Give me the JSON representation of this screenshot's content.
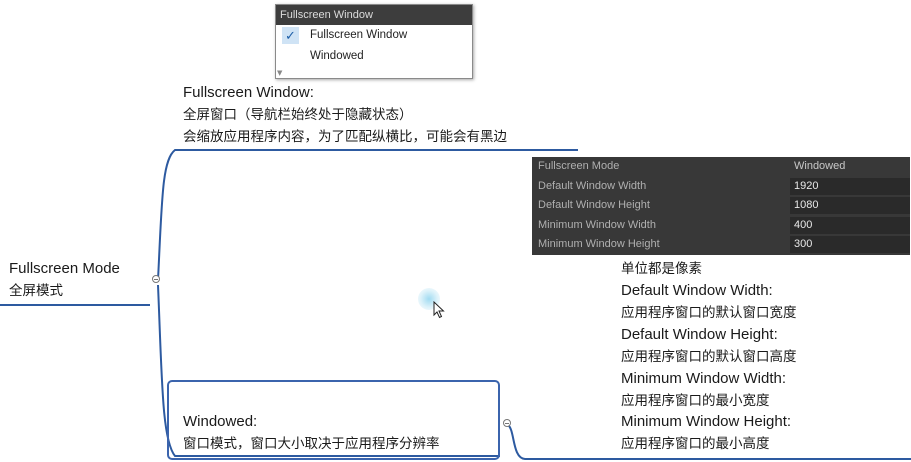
{
  "dropdown": {
    "header": "Fullscreen Window",
    "items": [
      {
        "label": "Fullscreen Window",
        "checked": true
      },
      {
        "label": "Windowed",
        "checked": false
      }
    ]
  },
  "root": {
    "title": "Fullscreen Mode",
    "subtitle": "全屏模式"
  },
  "fullscreen_node": {
    "title": "Fullscreen Window:",
    "line1": "全屏窗口（导航栏始终处于隐藏状态）",
    "line2": "会缩放应用程序内容，为了匹配纵横比，可能会有黑边"
  },
  "windowed_node": {
    "title": "Windowed:",
    "line1": "窗口模式，窗口大小取决于应用程序分辨率"
  },
  "settings": {
    "rows": [
      {
        "label": "Fullscreen Mode",
        "value": "Windowed"
      },
      {
        "label": "Default Window Width",
        "value": "1920"
      },
      {
        "label": "Default Window Height",
        "value": "1080"
      },
      {
        "label": "Minimum Window Width",
        "value": "400"
      },
      {
        "label": "Minimum Window Height",
        "value": "300"
      }
    ]
  },
  "notes": {
    "unit": "单位都是像素",
    "dww_title": "Default Window Width:",
    "dww_desc": "应用程序窗口的默认窗口宽度",
    "dwh_title": "Default Window Height:",
    "dwh_desc": "应用程序窗口的默认窗口高度",
    "mww_title": "Minimum Window Width:",
    "mww_desc": "应用程序窗口的最小宽度",
    "mwh_title": "Minimum Window Height:",
    "mwh_desc": "应用程序窗口的最小高度"
  },
  "colors": {
    "branch": "#2d5aa0",
    "panel": "#383838",
    "highlight": "#3b64ad"
  }
}
